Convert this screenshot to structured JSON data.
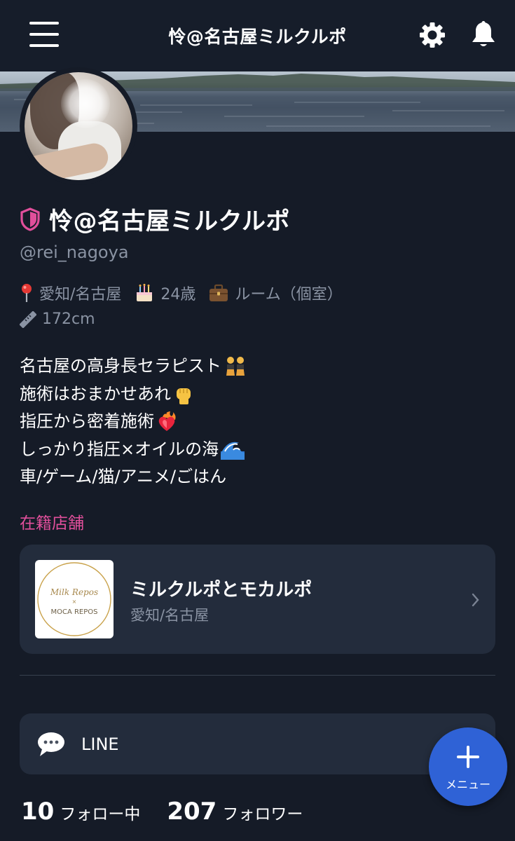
{
  "header": {
    "title": "怜@名古屋ミルクルポ",
    "menu_icon": "hamburger-menu-icon",
    "settings_icon": "gear-icon",
    "notifications_icon": "bell-icon"
  },
  "profile": {
    "display_name": "怜@名古屋ミルクルポ",
    "handle": "@rei_nagoya",
    "verified_icon": "shield-icon",
    "meta": {
      "location": "愛知/名古屋",
      "age": "24歳",
      "room": "ルーム（個室）",
      "height": "172cm"
    },
    "bio": [
      "名古屋の高身長セラピスト",
      "施術はおまかせあれ",
      "指圧から密着施術",
      "しっかり指圧×オイルの海",
      "車/ゲーム/猫/アニメ/ごはん"
    ]
  },
  "shop_section": {
    "label": "在籍店舗",
    "shop": {
      "name": "ミルクルポとモカルポ",
      "area": "愛知/名古屋",
      "logo_text_top": "Milk Repos",
      "logo_text_mid": "×",
      "logo_text_bottom": "MOCA REPOS"
    }
  },
  "line_link": {
    "label": "LINE"
  },
  "follow": {
    "following_count": "10",
    "following_label": "フォロー中",
    "followers_count": "207",
    "followers_label": "フォロワー"
  },
  "fab": {
    "label": "メニュー"
  },
  "colors": {
    "background": "#151b27",
    "card": "#232c3c",
    "accent_pink": "#e14f9b",
    "fab_blue": "#2f62d6",
    "muted_text": "#8a93a3"
  }
}
